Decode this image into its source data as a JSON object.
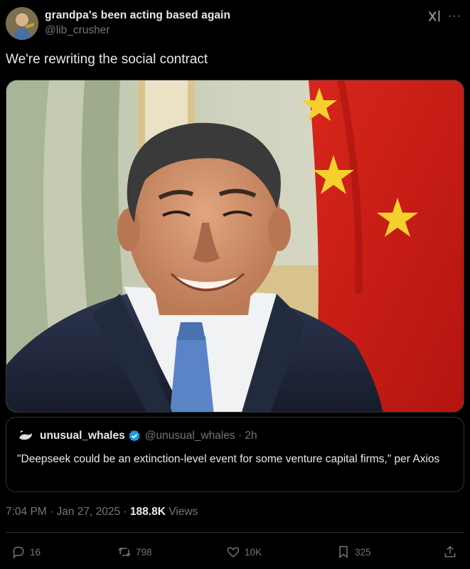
{
  "author": {
    "display_name": "grandpa's been acting based again",
    "handle": "@lib_crusher",
    "avatar_icon": "cartoon-avatar"
  },
  "header_icons": [
    "grok-icon",
    "more-icon"
  ],
  "more_glyph": "···",
  "tweet": {
    "text": "We're rewriting the social contract"
  },
  "media": {
    "kind": "photo",
    "subject": "smiling man in dark suit and blue tie in front of a red flag with yellow stars"
  },
  "quote": {
    "display_name": "unusual_whales",
    "verified": true,
    "handle_time": "@unusual_whales · 2h",
    "text": "\"Deepseek could be an extinction-level event for some venture capital firms,\" per Axios"
  },
  "meta": {
    "time_date": "7:04 PM · Jan 27, 2025 · ",
    "views_count": "188.8K",
    "views_label": " Views"
  },
  "actions": {
    "replies": "16",
    "reposts": "798",
    "likes": "10K",
    "bookmarks": "325"
  },
  "colors": {
    "background": "#000000",
    "text_primary": "#e7e9ea",
    "text_secondary": "#71767b",
    "border": "#2f3336",
    "verified": "#1d9bf0"
  }
}
